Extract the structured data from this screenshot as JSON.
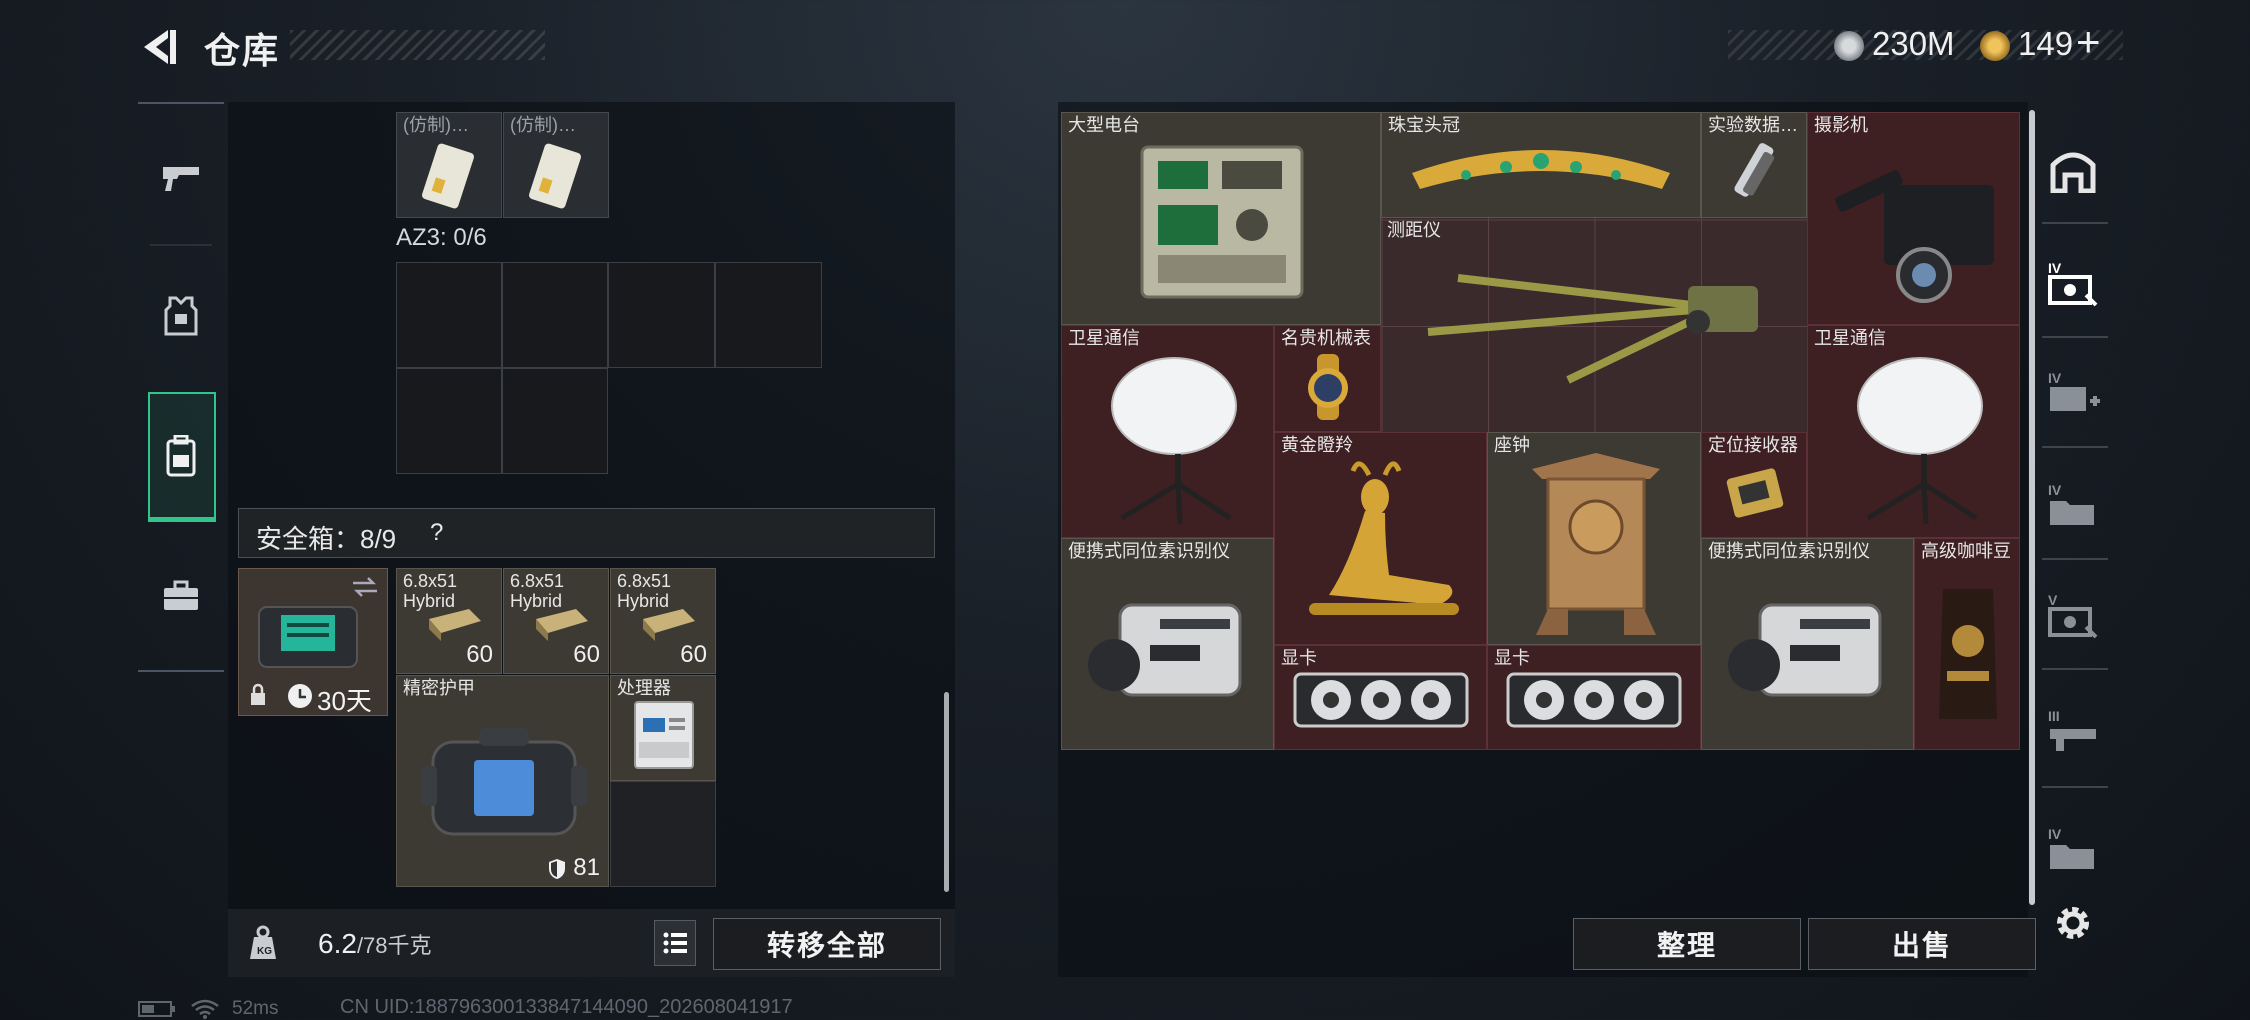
{
  "header": {
    "title": "仓库",
    "currency1": "230M",
    "currency2": "149",
    "currency2_add": "+"
  },
  "left_nav": {
    "items": [
      {
        "id": "weapons",
        "icon": "pistol-icon"
      },
      {
        "id": "armor",
        "icon": "vest-icon"
      },
      {
        "id": "backpack",
        "icon": "backpack-icon",
        "active": true
      },
      {
        "id": "case",
        "icon": "briefcase-icon"
      }
    ]
  },
  "container": {
    "top_items": [
      {
        "label": "(仿制)…"
      },
      {
        "label": "(仿制)…"
      }
    ],
    "az3_label": "AZ3: 0/6"
  },
  "safe_box": {
    "label": "安全箱：8/9",
    "help": "?",
    "timer": "30天",
    "items": [
      {
        "label": "6.8x51\nHybrid",
        "count": "60"
      },
      {
        "label": "6.8x51\nHybrid",
        "count": "60"
      },
      {
        "label": "6.8x51\nHybrid",
        "count": "60"
      },
      {
        "label": "精密护甲",
        "count": "81"
      },
      {
        "label": "处理器",
        "count": ""
      }
    ]
  },
  "footer_left": {
    "weight_value": "6.2",
    "weight_max": "/78千克",
    "transfer_all": "转移全部"
  },
  "stash": {
    "items": [
      {
        "label": "大型电台"
      },
      {
        "label": "珠宝头冠"
      },
      {
        "label": "实验数据…"
      },
      {
        "label": "摄影机"
      },
      {
        "label": "测距仪"
      },
      {
        "label": "卫星通信"
      },
      {
        "label": "名贵机械表"
      },
      {
        "label": "卫星通信"
      },
      {
        "label": "黄金瞪羚"
      },
      {
        "label": "座钟"
      },
      {
        "label": "定位接收器"
      },
      {
        "label": "便携式同位素识别仪"
      },
      {
        "label": "便携式同位素识别仪"
      },
      {
        "label": "高级咖啡豆"
      },
      {
        "label": "显卡"
      },
      {
        "label": "显卡"
      }
    ]
  },
  "footer_right": {
    "sort": "整理",
    "sell": "出售"
  },
  "status_bar": {
    "ping": "52ms",
    "uid": "CN UID:1887963001338471440​90_202608041917"
  }
}
